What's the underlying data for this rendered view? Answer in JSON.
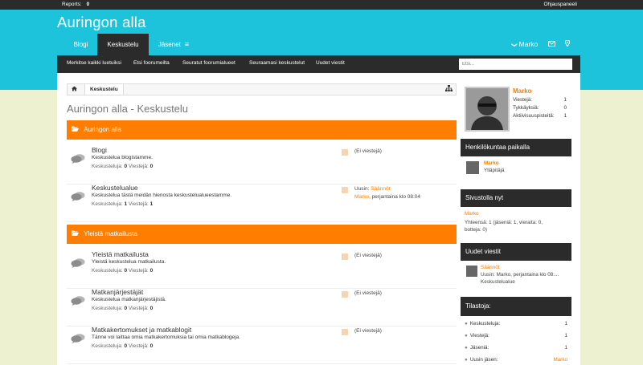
{
  "adminbar": {
    "reports_label": "Reports:",
    "reports_count": "0",
    "control_panel": "Ohjauspaneeli"
  },
  "site": {
    "title": "Auringon alla"
  },
  "tabs": [
    {
      "label": "Blogi"
    },
    {
      "label": "Keskustelu"
    },
    {
      "label": "Jäsenet"
    }
  ],
  "tabs_burger": "≡",
  "user_nav": {
    "username": "Marko",
    "chevron": "❯",
    "mail_icon": "envelope-icon",
    "pin_icon": "map-pin-icon"
  },
  "subnav": {
    "links": [
      "Merkitse kaikki luetuiksi",
      "Etsi foorumeilta",
      "Seuratut foorumialueet",
      "Seuraamasi keskustelut",
      "Uudet viestit"
    ],
    "search_placeholder": "Etsi..."
  },
  "breadcrumb": {
    "home_icon": "home-icon",
    "current": "Keskustelu",
    "tree_icon": "sitemap-icon"
  },
  "page_title": "Auringon alla - Keskustelu",
  "categories": [
    {
      "title": "Auringon alla"
    },
    {
      "title": "Yleistä matkailusta"
    }
  ],
  "forums": [
    {
      "title": "Blogi",
      "desc": "Keskustelua blogistamme.",
      "threads_label": "Keskusteluja:",
      "threads": "0",
      "posts_label": "Viestejä:",
      "posts": "0",
      "last_line1": "(Ei viestejä)",
      "last_prefix": "",
      "last_link": "",
      "last_line2_link": "",
      "last_line2": ""
    },
    {
      "title": "Keskustelualue",
      "desc": "Keskustelua tästä meidän hienosta keskustelualueestamme.",
      "threads_label": "Keskusteluja:",
      "threads": "1",
      "posts_label": "Viestejä:",
      "posts": "1",
      "last_line1": "",
      "last_prefix": "Uusin: ",
      "last_link": "Säännöt",
      "last_line2_link": "Marko",
      "last_line2": ", perjantaina klo 08:04"
    },
    {
      "title": "Yleistä matkailusta",
      "desc": "Yleistä keskustelua matkailusta.",
      "threads_label": "Keskusteluja:",
      "threads": "0",
      "posts_label": "Viestejä:",
      "posts": "0",
      "last_line1": "(Ei viestejä)",
      "last_prefix": "",
      "last_link": "",
      "last_line2_link": "",
      "last_line2": ""
    },
    {
      "title": "Matkanjärjestäjät",
      "desc": "Keskustelua matkanjärjestäjistä.",
      "threads_label": "Keskusteluja:",
      "threads": "0",
      "posts_label": "Viestejä:",
      "posts": "0",
      "last_line1": "(Ei viestejä)",
      "last_prefix": "",
      "last_link": "",
      "last_line2_link": "",
      "last_line2": ""
    },
    {
      "title": "Matkakertomukset ja matkablogit",
      "desc": "Tänne voi laittaa omia matkakertomuksia tai omia matkablogeja.",
      "threads_label": "Keskusteluja:",
      "threads": "0",
      "posts_label": "Viestejä:",
      "posts": "0",
      "last_line1": "(Ei viestejä)",
      "last_prefix": "",
      "last_link": "",
      "last_line2_link": "",
      "last_line2": ""
    }
  ],
  "profile": {
    "name": "Marko",
    "rows": [
      {
        "label": "Viestejä:",
        "value": "1"
      },
      {
        "label": "Tykkäyksiä:",
        "value": "0"
      },
      {
        "label": "Aktiivisuuspisteitä:",
        "value": "1"
      }
    ]
  },
  "staff": {
    "heading": "Henkilökuntaa paikalla",
    "name": "Marko",
    "role": "Ylläpitäjä"
  },
  "online": {
    "heading": "Sivustolla nyt",
    "name": "Marko",
    "summary_line1": "Yhteensä: 1 (jäseniä: 1, vieraita: 0,",
    "summary_line2": "botteja: 0)"
  },
  "new_posts": {
    "heading": "Uudet viestit",
    "title": "Säännöt",
    "line1": "Uusin: Marko, perjantaina klo 08:...",
    "line2": "Keskustelualue"
  },
  "stats": {
    "heading": "Tilastoja:",
    "rows": [
      {
        "icon": "comments-icon",
        "label": "Keskusteluja:",
        "value": "1"
      },
      {
        "icon": "comment-icon",
        "label": "Viestejä:",
        "value": "1"
      },
      {
        "icon": "users-icon",
        "label": "Jäseniä:",
        "value": "1"
      },
      {
        "icon": "user-icon",
        "label": "Uusin jäsen:",
        "value": "Marko"
      }
    ]
  },
  "colors": {
    "accent": "#ff7d00",
    "header": "#1dc2db",
    "dark": "#2b2b2b",
    "background": "#eef1cf"
  }
}
